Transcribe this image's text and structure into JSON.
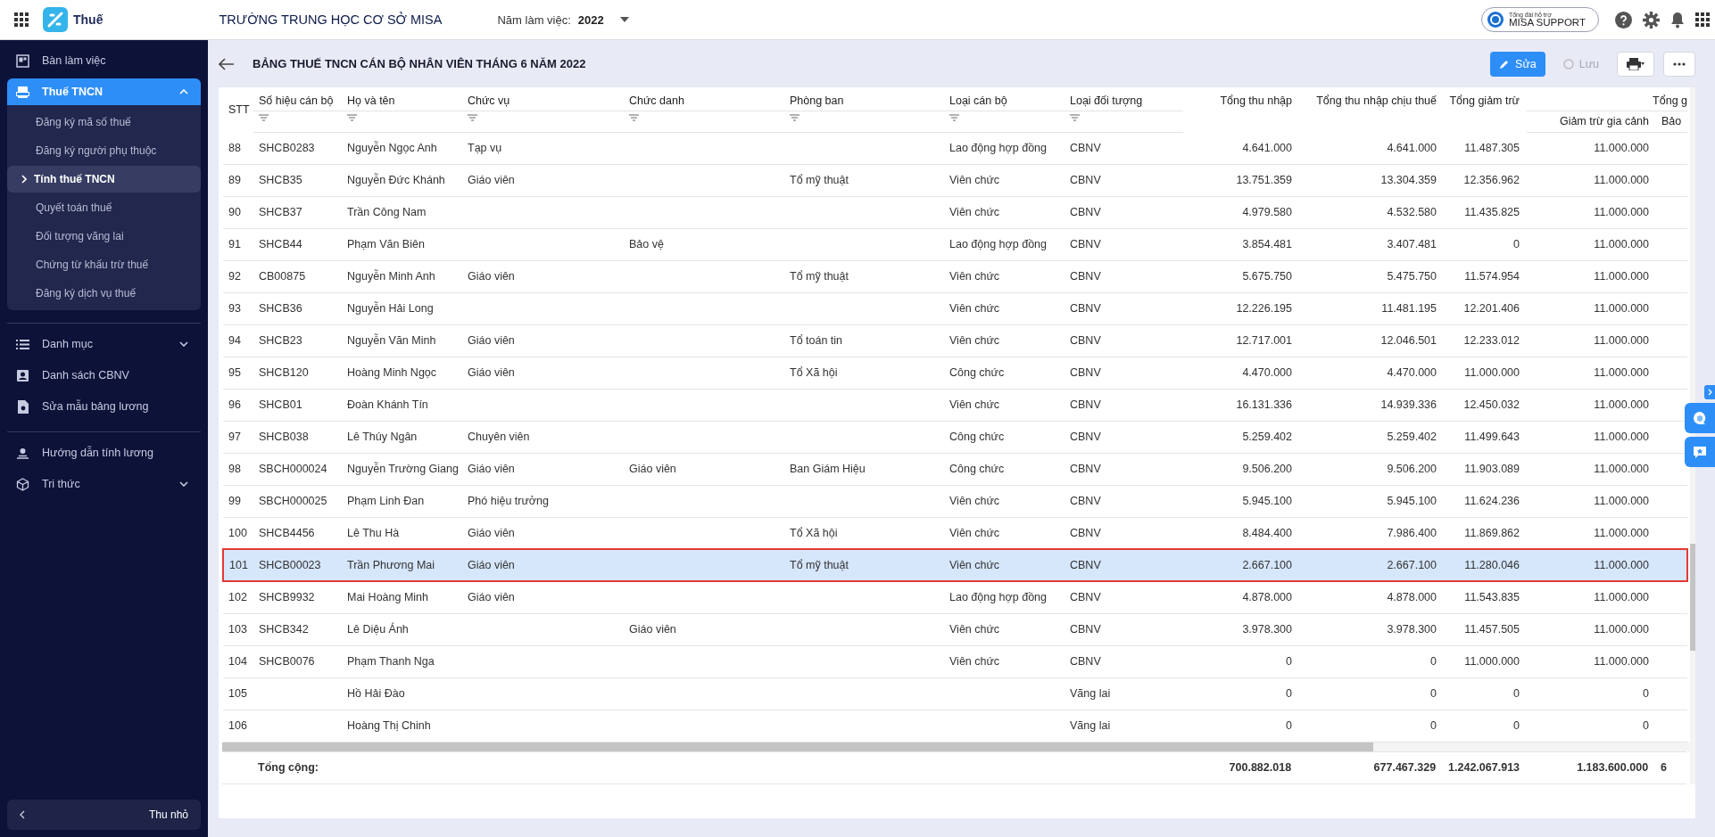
{
  "topbar": {
    "app_name": "Thuế",
    "school": "TRƯỜNG TRUNG HỌC CƠ SỞ MISA",
    "year_label": "Năm làm việc:",
    "year": "2022",
    "support_caption": "Tổng đài hỗ trợ",
    "support_label": "MISA SUPPORT"
  },
  "sidebar": {
    "groups": [
      {
        "items": [
          {
            "label": "Bàn làm việc",
            "selected": false
          },
          {
            "label": "Thuế TNCN",
            "selected": true,
            "expanded": true,
            "children": [
              {
                "label": "Đăng ký mã số thuế",
                "selected": false
              },
              {
                "label": "Đăng ký người phụ thuộc",
                "selected": false
              },
              {
                "label": "Tính thuế TNCN",
                "selected": true
              },
              {
                "label": "Quyết toán thuế",
                "selected": false
              },
              {
                "label": "Đối tượng vãng lai",
                "selected": false
              },
              {
                "label": "Chứng từ khấu trừ thuế",
                "selected": false
              },
              {
                "label": "Đăng ký dịch vụ thuế",
                "selected": false
              }
            ]
          }
        ]
      },
      {
        "items": [
          {
            "label": "Danh mục",
            "selected": false,
            "expanded": false
          },
          {
            "label": "Danh sách CBNV",
            "selected": false
          },
          {
            "label": "Sửa mẫu bảng lương",
            "selected": false
          }
        ]
      },
      {
        "items": [
          {
            "label": "Hướng dẫn tính lương",
            "selected": false
          },
          {
            "label": "Tri thức",
            "selected": false,
            "expanded": false
          }
        ]
      }
    ],
    "collapse_label": "Thu nhỏ"
  },
  "page": {
    "title": "BẢNG THUẾ TNCN CÁN BỘ NHÂN VIÊN THÁNG 6 NĂM 2022",
    "edit_button": "Sửa",
    "save_button": {
      "label": "Lưu",
      "disabled": true
    }
  },
  "table": {
    "columns": [
      {
        "label": "STT",
        "kind": "text"
      },
      {
        "label": "Số hiệu cán bộ",
        "kind": "text",
        "filterable": true
      },
      {
        "label": "Họ và tên",
        "kind": "text",
        "filterable": true
      },
      {
        "label": "Chức vụ",
        "kind": "text",
        "filterable": true
      },
      {
        "label": "Chức danh",
        "kind": "text",
        "filterable": true
      },
      {
        "label": "Phòng ban",
        "kind": "text",
        "filterable": true
      },
      {
        "label": "Loại cán bộ",
        "kind": "text",
        "filterable": true
      },
      {
        "label": "Loại đối tượng",
        "kind": "text",
        "filterable": true
      },
      {
        "label": "Tổng thu nhập",
        "kind": "number",
        "filterable": false
      },
      {
        "label": "Tổng thu nhập chịu thuế",
        "kind": "number",
        "filterable": false
      },
      {
        "label": "Tổng giảm trừ",
        "kind": "number",
        "filterable": false
      }
    ],
    "column_group": {
      "label": "Tổng g",
      "columns": [
        {
          "label": "Giảm trừ gia cảnh",
          "kind": "number"
        },
        {
          "label": "Bảo",
          "kind": "text"
        }
      ]
    },
    "rows": [
      {
        "selected": false,
        "cells": [
          "88",
          "SHCB0283",
          "Nguyễn Ngọc Anh",
          "Tạp vụ",
          "",
          "",
          "Lao động hợp đồng",
          "CBNV",
          "4.641.000",
          "4.641.000",
          "11.487.305",
          "11.000.000",
          ""
        ]
      },
      {
        "selected": false,
        "cells": [
          "89",
          "SHCB35",
          "Nguyễn Đức Khánh",
          "Giáo viên",
          "",
          "Tổ mỹ thuật",
          "Viên chức",
          "CBNV",
          "13.751.359",
          "13.304.359",
          "12.356.962",
          "11.000.000",
          ""
        ]
      },
      {
        "selected": false,
        "cells": [
          "90",
          "SHCB37",
          "Trần Công Nam",
          "",
          "",
          "",
          "Viên chức",
          "CBNV",
          "4.979.580",
          "4.532.580",
          "11.435.825",
          "11.000.000",
          ""
        ]
      },
      {
        "selected": false,
        "cells": [
          "91",
          "SHCB44",
          "Phạm Văn Biên",
          "",
          "Bảo vệ",
          "",
          "Lao động hợp đồng",
          "CBNV",
          "3.854.481",
          "3.407.481",
          "0",
          "11.000.000",
          ""
        ]
      },
      {
        "selected": false,
        "cells": [
          "92",
          "CB00875",
          "Nguyễn Minh Anh",
          "Giáo viên",
          "",
          "Tổ mỹ thuật",
          "Viên chức",
          "CBNV",
          "5.675.750",
          "5.475.750",
          "11.574.954",
          "11.000.000",
          ""
        ]
      },
      {
        "selected": false,
        "cells": [
          "93",
          "SHCB36",
          "Nguyễn Hải Long",
          "",
          "",
          "",
          "Viên chức",
          "CBNV",
          "12.226.195",
          "11.481.195",
          "12.201.406",
          "11.000.000",
          ""
        ]
      },
      {
        "selected": false,
        "cells": [
          "94",
          "SHCB23",
          "Nguyễn Văn Minh",
          "Giáo viên",
          "",
          "Tổ toán tin",
          "Viên chức",
          "CBNV",
          "12.717.001",
          "12.046.501",
          "12.233.012",
          "11.000.000",
          ""
        ]
      },
      {
        "selected": false,
        "cells": [
          "95",
          "SHCB120",
          "Hoàng Minh Ngọc",
          "Giáo viên",
          "",
          "Tổ Xã hội",
          "Công chức",
          "CBNV",
          "4.470.000",
          "4.470.000",
          "11.000.000",
          "11.000.000",
          ""
        ]
      },
      {
        "selected": false,
        "cells": [
          "96",
          "SHCB01",
          "Đoàn Khánh Tín",
          "",
          "",
          "",
          "Viên chức",
          "CBNV",
          "16.131.336",
          "14.939.336",
          "12.450.032",
          "11.000.000",
          ""
        ]
      },
      {
        "selected": false,
        "cells": [
          "97",
          "SHCB038",
          "Lê Thúy Ngân",
          "Chuyên viên",
          "",
          "",
          "Công chức",
          "CBNV",
          "5.259.402",
          "5.259.402",
          "11.499.643",
          "11.000.000",
          ""
        ]
      },
      {
        "selected": false,
        "cells": [
          "98",
          "SBCH000024",
          "Nguyễn Trường Giang",
          "Giáo viên",
          "Giáo viên",
          "Ban Giám Hiệu",
          "Công chức",
          "CBNV",
          "9.506.200",
          "9.506.200",
          "11.903.089",
          "11.000.000",
          ""
        ]
      },
      {
        "selected": false,
        "cells": [
          "99",
          "SBCH000025",
          "Phạm Linh Đan",
          "Phó hiệu trưởng",
          "",
          "",
          "Viên chức",
          "CBNV",
          "5.945.100",
          "5.945.100",
          "11.624.236",
          "11.000.000",
          ""
        ]
      },
      {
        "selected": false,
        "cells": [
          "100",
          "SHCB4456",
          "Lê Thu Hà",
          "Giáo viên",
          "",
          "Tổ Xã hội",
          "Viên chức",
          "CBNV",
          "8.484.400",
          "7.986.400",
          "11.869.862",
          "11.000.000",
          ""
        ]
      },
      {
        "selected": true,
        "cells": [
          "101",
          "SHCB00023",
          "Trần Phương Mai",
          "Giáo viên",
          "",
          "Tổ mỹ thuật",
          "Viên chức",
          "CBNV",
          "2.667.100",
          "2.667.100",
          "11.280.046",
          "11.000.000",
          ""
        ]
      },
      {
        "selected": false,
        "cells": [
          "102",
          "SHCB9932",
          "Mai Hoàng Minh",
          "Giáo viên",
          "",
          "",
          "Lao động hợp đồng",
          "CBNV",
          "4.878.000",
          "4.878.000",
          "11.543.835",
          "11.000.000",
          ""
        ]
      },
      {
        "selected": false,
        "cells": [
          "103",
          "SHCB342",
          "Lê Diệu Ánh",
          "",
          "Giáo viên",
          "",
          "Viên chức",
          "CBNV",
          "3.978.300",
          "3.978.300",
          "11.457.505",
          "11.000.000",
          ""
        ]
      },
      {
        "selected": false,
        "cells": [
          "104",
          "SHCB0076",
          "Phạm Thanh Nga",
          "",
          "",
          "",
          "Viên chức",
          "CBNV",
          "0",
          "0",
          "11.000.000",
          "11.000.000",
          ""
        ]
      },
      {
        "selected": false,
        "cells": [
          "105",
          "",
          "Hồ Hải Đào",
          "",
          "",
          "",
          "",
          "Vãng lai",
          "0",
          "0",
          "0",
          "0",
          ""
        ]
      },
      {
        "selected": false,
        "cells": [
          "106",
          "",
          "Hoàng Thị Chinh",
          "",
          "",
          "",
          "",
          "Vãng lai",
          "0",
          "0",
          "0",
          "0",
          ""
        ]
      }
    ],
    "total": {
      "label": "Tổng cộng:",
      "values": [
        "700.882.018",
        "677.467.329",
        "1.242.067.913",
        "1.183.600.000",
        "6"
      ]
    }
  }
}
